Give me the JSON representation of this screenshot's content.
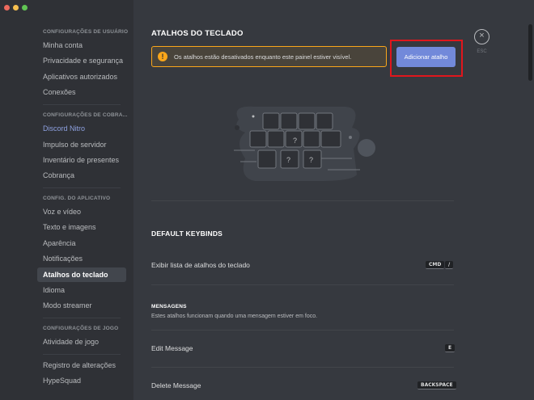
{
  "sidebar": {
    "sections": [
      {
        "header": "CONFIGURAÇÕES DE USUÁRIO",
        "items": [
          "Minha conta",
          "Privacidade e segurança",
          "Aplicativos autorizados",
          "Conexões"
        ]
      },
      {
        "header": "CONFIGURAÇÕES DE COBRA...",
        "items": [
          "Discord Nitro",
          "Impulso de servidor",
          "Inventário de presentes",
          "Cobrança"
        ]
      },
      {
        "header": "CONFIG. DO APLICATIVO",
        "items": [
          "Voz e vídeo",
          "Texto e imagens",
          "Aparência",
          "Notificações",
          "Atalhos do teclado",
          "Idioma",
          "Modo streamer"
        ]
      },
      {
        "header": "CONFIGURAÇÕES DE JOGO",
        "items": [
          "Atividade de jogo"
        ]
      }
    ],
    "extra_items": [
      "Registro de alterações",
      "HypeSquad"
    ],
    "active_item": "Atalhos do teclado"
  },
  "main": {
    "title": "ATALHOS DO TECLADO",
    "warning_icon": "!",
    "warning_text": "Os atalhos estão desativados enquanto este painel estiver visível.",
    "add_button": "Adicionar atalho",
    "close_icon": "×",
    "esc_label": "ESC",
    "illustration_marks": [
      "?",
      "?",
      "?"
    ],
    "default_title": "DEFAULT KEYBINDS",
    "keybind_toggle": {
      "label": "Exibir lista de atalhos do teclado",
      "keys": [
        "CMD",
        "/"
      ]
    },
    "messages_header": "MENSAGENS",
    "messages_desc": "Estes atalhos funcionam quando uma mensagem estiver em foco.",
    "edit_message": {
      "label": "Edit Message",
      "key": "E"
    },
    "delete_message": {
      "label": "Delete Message",
      "key": "BACKSPACE"
    }
  },
  "colors": {
    "sidebar_bg": "#2f3136",
    "main_bg": "#36393f",
    "accent": "#7289da",
    "warning": "#faa61a",
    "highlight": "#e0161c"
  }
}
